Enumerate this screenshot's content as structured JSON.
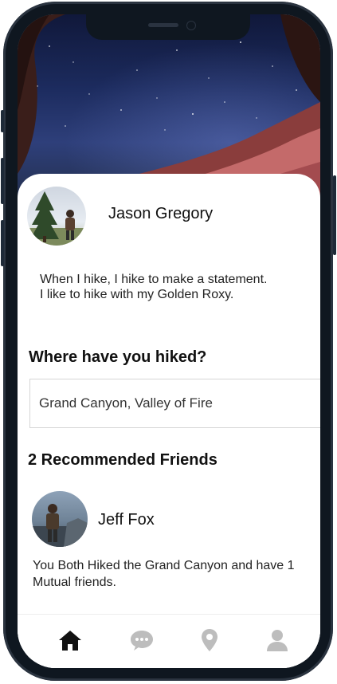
{
  "profile": {
    "name": "Jason Gregory",
    "bio_line1": "When I hike, I hike to make a statement.",
    "bio_line2": "I like to hike with my Golden Roxy."
  },
  "hiked": {
    "title": "Where have you hiked?",
    "value": "Grand Canyon, Valley of Fire"
  },
  "friends": {
    "title": "2 Recommended Friends",
    "items": [
      {
        "name": "Jeff Fox",
        "description": "You Both Hiked the Grand Canyon and have 1 Mutual friends."
      }
    ]
  },
  "tabbar": {
    "active_color": "#111111",
    "inactive_color": "#bdbdbd",
    "items": [
      {
        "icon": "home-icon",
        "active": true
      },
      {
        "icon": "chat-icon",
        "active": false
      },
      {
        "icon": "location-pin-icon",
        "active": false
      },
      {
        "icon": "user-icon",
        "active": false
      }
    ]
  }
}
